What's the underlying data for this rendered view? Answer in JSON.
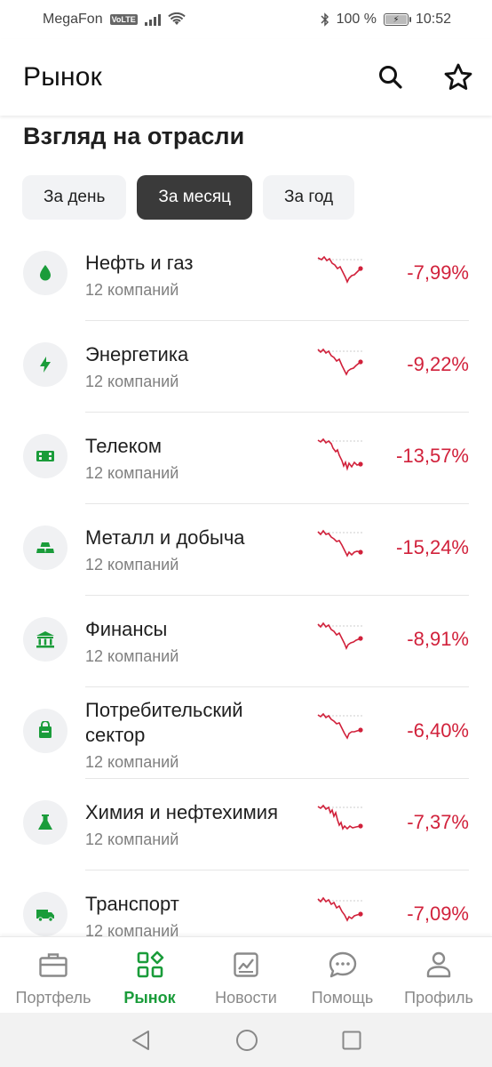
{
  "status_bar": {
    "carrier": "MegaFon",
    "volte": "VoLTE",
    "battery": "100 %",
    "battery_level": 1.0,
    "time": "10:52"
  },
  "header": {
    "title": "Рынок",
    "search_icon": "search-icon",
    "favorite_icon": "star-icon"
  },
  "section": {
    "title": "Взгляд на отрасли"
  },
  "period_tabs": [
    {
      "label": "За день",
      "active": false
    },
    {
      "label": "За месяц",
      "active": true
    },
    {
      "label": "За год",
      "active": false
    }
  ],
  "colors": {
    "accent_green": "#1a9c3a",
    "negative": "#d1213b",
    "tab_active_bg": "#3a3a3a",
    "icon_bg": "#f0f1f3"
  },
  "sectors": [
    {
      "name": "Нефть и газ",
      "count": "12 компаний",
      "change": "-7,99%",
      "icon": "oil-drop-icon"
    },
    {
      "name": "Энергетика",
      "count": "12 компаний",
      "change": "-9,22%",
      "icon": "lightning-icon"
    },
    {
      "name": "Телеком",
      "count": "12 компаний",
      "change": "-13,57%",
      "icon": "sim-card-icon"
    },
    {
      "name": "Металл и добыча",
      "count": "12 компаний",
      "change": "-15,24%",
      "icon": "gold-bars-icon"
    },
    {
      "name": "Финансы",
      "count": "12 компаний",
      "change": "-8,91%",
      "icon": "bank-icon"
    },
    {
      "name": "Потребительский сектор",
      "count": "12 компаний",
      "change": "-6,40%",
      "icon": "shopping-bag-icon"
    },
    {
      "name": "Химия и нефтехимия",
      "count": "12 компаний",
      "change": "-7,37%",
      "icon": "flask-icon"
    },
    {
      "name": "Транспорт",
      "count": "12 компаний",
      "change": "-7,09%",
      "icon": "truck-icon"
    }
  ],
  "bottom_nav": [
    {
      "label": "Портфель",
      "icon": "briefcase-icon",
      "active": false
    },
    {
      "label": "Рынок",
      "icon": "market-grid-icon",
      "active": true
    },
    {
      "label": "Новости",
      "icon": "news-chart-icon",
      "active": false
    },
    {
      "label": "Помощь",
      "icon": "chat-bubble-icon",
      "active": false
    },
    {
      "label": "Профиль",
      "icon": "person-icon",
      "active": false
    }
  ],
  "system_nav": {
    "back": "back-triangle-icon",
    "home": "home-circle-icon",
    "recents": "recents-square-icon"
  }
}
